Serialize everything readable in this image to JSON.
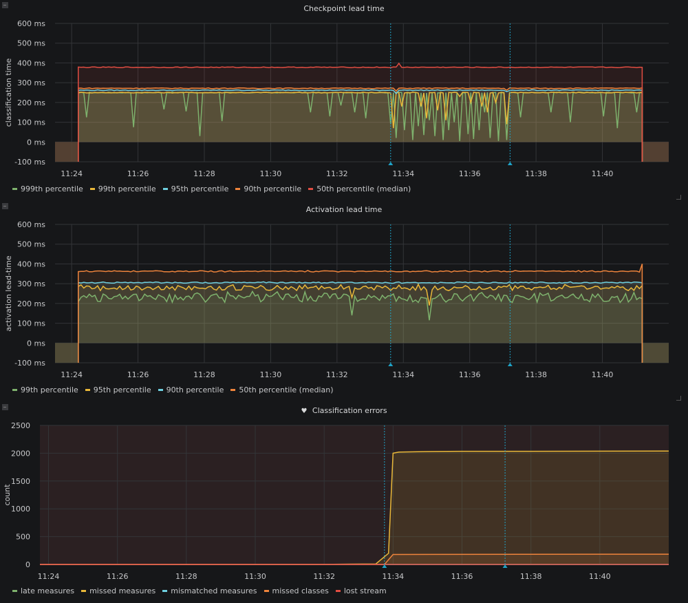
{
  "colors": {
    "green": "#7eb26d",
    "yellow": "#eab839",
    "cyan": "#6ed0e0",
    "orange": "#ef843c",
    "red": "#e24d42",
    "annotation": "#1fa3c7"
  },
  "panels": [
    {
      "title": "Checkpoint lead time",
      "title_icon": "",
      "icon": "panel-menu-icon",
      "chart_data": {
        "type": "line",
        "title": "Checkpoint lead time",
        "ylabel": "classification time",
        "xlabel": "",
        "x_ticks": [
          "11:24",
          "11:26",
          "11:28",
          "11:30",
          "11:32",
          "11:34",
          "11:36",
          "11:38",
          "11:40"
        ],
        "x_range": [
          "11:23:30",
          "11:42"
        ],
        "y_ticks": [
          "-100 ms",
          "0 ms",
          "100 ms",
          "200 ms",
          "300 ms",
          "400 ms",
          "500 ms",
          "600 ms"
        ],
        "ylim": [
          -100,
          600
        ],
        "grid": true,
        "legend_position": "bottom-left",
        "annotations_minutes": [
          "11:33:37",
          "11:37:13"
        ],
        "start": "11:24:12",
        "end": "11:41:12",
        "series": [
          {
            "name": "999th percentile",
            "color": "#7eb26d",
            "base": 250,
            "dips": [
              [
                "11:24:25",
                125
              ],
              [
                "11:25:50",
                75
              ],
              [
                "11:26:45",
                165
              ],
              [
                "11:27:25",
                155
              ],
              [
                "11:27:50",
                30
              ],
              [
                "11:28:30",
                105
              ],
              [
                "11:31:10",
                150
              ],
              [
                "11:31:45",
                130
              ],
              [
                "11:32:05",
                185
              ],
              [
                "11:32:30",
                150
              ],
              [
                "11:32:50",
                120
              ],
              [
                "11:33:35",
                90
              ],
              [
                "11:33:45",
                20
              ],
              [
                "11:34:00",
                60
              ],
              [
                "11:34:15",
                10
              ],
              [
                "11:34:25",
                80
              ],
              [
                "11:34:35",
                35
              ],
              [
                "11:34:45",
                110
              ],
              [
                "11:34:55",
                30
              ],
              [
                "11:35:10",
                10
              ],
              [
                "11:35:20",
                60
              ],
              [
                "11:35:30",
                100
              ],
              [
                "11:35:40",
                5
              ],
              [
                "11:35:55",
                40
              ],
              [
                "11:36:05",
                15
              ],
              [
                "11:36:15",
                60
              ],
              [
                "11:36:25",
                150
              ],
              [
                "11:36:35",
                20
              ],
              [
                "11:36:50",
                5
              ],
              [
                "11:37:05",
                10
              ],
              [
                "11:37:30",
                125
              ],
              [
                "11:38:25",
                150
              ],
              [
                "11:39:00",
                100
              ],
              [
                "11:40:00",
                130
              ],
              [
                "11:40:25",
                70
              ],
              [
                "11:41:00",
                150
              ]
            ]
          },
          {
            "name": "99th percentile",
            "color": "#eab839",
            "base": 250,
            "dips": [
              [
                "11:33:40",
                70
              ],
              [
                "11:33:55",
                180
              ],
              [
                "11:34:30",
                180
              ],
              [
                "11:34:40",
                120
              ],
              [
                "11:35:00",
                160
              ],
              [
                "11:35:15",
                110
              ],
              [
                "11:35:40",
                230
              ],
              [
                "11:36:00",
                200
              ],
              [
                "11:36:20",
                180
              ],
              [
                "11:36:30",
                150
              ],
              [
                "11:36:45",
                200
              ],
              [
                "11:37:05",
                90
              ]
            ]
          },
          {
            "name": "95th percentile",
            "color": "#6ed0e0",
            "base": 262,
            "dips": [
              [
                "11:33:45",
                245
              ],
              [
                "11:37:05",
                255
              ]
            ]
          },
          {
            "name": "90th percentile",
            "color": "#ef843c",
            "base": 272,
            "dips": [
              [
                "11:33:45",
                258
              ],
              [
                "11:37:05",
                262
              ]
            ]
          },
          {
            "name": "50th percentile (median)",
            "color": "#e24d42",
            "base": 378,
            "dips": [
              [
                "11:33:50",
                398
              ]
            ]
          }
        ]
      },
      "legend": [
        "999th percentile",
        "99th percentile",
        "95th percentile",
        "90th percentile",
        "50th percentile (median)"
      ]
    },
    {
      "title": "Activation lead time",
      "title_icon": "",
      "icon": "panel-menu-icon",
      "chart_data": {
        "type": "line",
        "title": "Activation lead time",
        "ylabel": "activation lead-time",
        "xlabel": "",
        "x_ticks": [
          "11:24",
          "11:26",
          "11:28",
          "11:30",
          "11:32",
          "11:34",
          "11:36",
          "11:38",
          "11:40"
        ],
        "x_range": [
          "11:23:30",
          "11:42"
        ],
        "y_ticks": [
          "-100 ms",
          "0 ms",
          "100 ms",
          "200 ms",
          "300 ms",
          "400 ms",
          "500 ms",
          "600 ms"
        ],
        "ylim": [
          -100,
          600
        ],
        "grid": true,
        "legend_position": "bottom-left",
        "annotations_minutes": [
          "11:33:37",
          "11:37:13"
        ],
        "start": "11:24:12",
        "end": "11:41:12",
        "series": [
          {
            "name": "99th percentile",
            "color": "#7eb26d",
            "base": 250,
            "noise": 45,
            "dips": [
              [
                "11:32:25",
                140
              ],
              [
                "11:34:45",
                115
              ]
            ]
          },
          {
            "name": "95th percentile",
            "color": "#eab839",
            "base": 290,
            "noise": 25,
            "dips": [
              [
                "11:32:25",
                230
              ],
              [
                "11:34:45",
                190
              ]
            ]
          },
          {
            "name": "90th percentile",
            "color": "#6ed0e0",
            "base": 308,
            "noise": 6,
            "dips": []
          },
          {
            "name": "50th percentile (median)",
            "color": "#ef843c",
            "base": 365,
            "noise": 6,
            "dips": [
              [
                "11:41:10",
                400
              ]
            ]
          }
        ]
      },
      "legend": [
        "99th percentile",
        "95th percentile",
        "90th percentile",
        "50th percentile (median)"
      ]
    },
    {
      "title": "Classification errors",
      "title_icon": "♥",
      "icon": "panel-menu-icon",
      "chart_data": {
        "type": "line",
        "title": "Classification errors",
        "ylabel": "count",
        "xlabel": "",
        "x_ticks": [
          "11:24",
          "11:26",
          "11:28",
          "11:30",
          "11:32",
          "11:34",
          "11:36",
          "11:38",
          "11:40"
        ],
        "x_range": [
          "11:23:45",
          "11:42"
        ],
        "y_ticks": [
          "0",
          "500",
          "1000",
          "1500",
          "2000",
          "2500"
        ],
        "ylim": [
          0,
          2500
        ],
        "grid": true,
        "legend_position": "bottom-left",
        "annotations_minutes": [
          "11:33:45",
          "11:37:15"
        ],
        "series": [
          {
            "name": "late measures",
            "color": "#7eb26d",
            "points": [
              [
                "11:23:45",
                0
              ],
              [
                "11:42:00",
                0
              ]
            ]
          },
          {
            "name": "missed measures",
            "color": "#eab839",
            "points": [
              [
                "11:23:45",
                0
              ],
              [
                "11:31:45",
                0
              ],
              [
                "11:33:30",
                10
              ],
              [
                "11:33:52",
                200
              ],
              [
                "11:34:00",
                2000
              ],
              [
                "11:34:10",
                2020
              ],
              [
                "11:35:00",
                2030
              ],
              [
                "11:36:00",
                2035
              ],
              [
                "11:38:00",
                2035
              ],
              [
                "11:42:00",
                2040
              ]
            ]
          },
          {
            "name": "mismatched measures",
            "color": "#6ed0e0",
            "points": [
              [
                "11:23:45",
                0
              ],
              [
                "11:42:00",
                0
              ]
            ]
          },
          {
            "name": "missed classes",
            "color": "#ef843c",
            "points": [
              [
                "11:23:45",
                0
              ],
              [
                "11:33:45",
                0
              ],
              [
                "11:34:00",
                180
              ],
              [
                "11:42:00",
                185
              ]
            ]
          },
          {
            "name": "lost stream",
            "color": "#e24d42",
            "points": [
              [
                "11:23:45",
                0
              ],
              [
                "11:42:00",
                0
              ]
            ]
          }
        ]
      },
      "legend": [
        "late measures",
        "missed measures",
        "mismatched measures",
        "missed classes",
        "lost stream"
      ]
    }
  ]
}
